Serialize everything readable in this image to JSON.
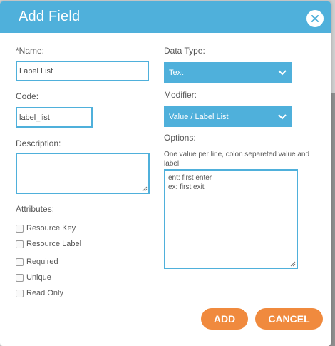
{
  "dialog": {
    "title": "Add Field",
    "close_icon": "close-icon"
  },
  "form": {
    "name": {
      "label": "*Name:",
      "value": "Label List"
    },
    "code": {
      "label": "Code:",
      "value": "label_list"
    },
    "description": {
      "label": "Description:",
      "value": ""
    },
    "attributes": {
      "label": "Attributes:",
      "items": [
        {
          "label": "Resource Key",
          "checked": false
        },
        {
          "label": "Resource Label",
          "checked": false
        },
        {
          "label": "Required",
          "checked": false
        },
        {
          "label": "Unique",
          "checked": false
        },
        {
          "label": "Read Only",
          "checked": false
        }
      ]
    },
    "data_type": {
      "label": "Data Type:",
      "value": "Text"
    },
    "modifier": {
      "label": "Modifier:",
      "value": "Value / Label List"
    },
    "options": {
      "label": "Options:",
      "hint": "One value per line, colon separeted value and label",
      "value": "ent: first enter\nex: first exit\n"
    }
  },
  "buttons": {
    "add": "ADD",
    "cancel": "CANCEL"
  },
  "colors": {
    "accent": "#4fb0db",
    "button": "#f08a3e"
  }
}
